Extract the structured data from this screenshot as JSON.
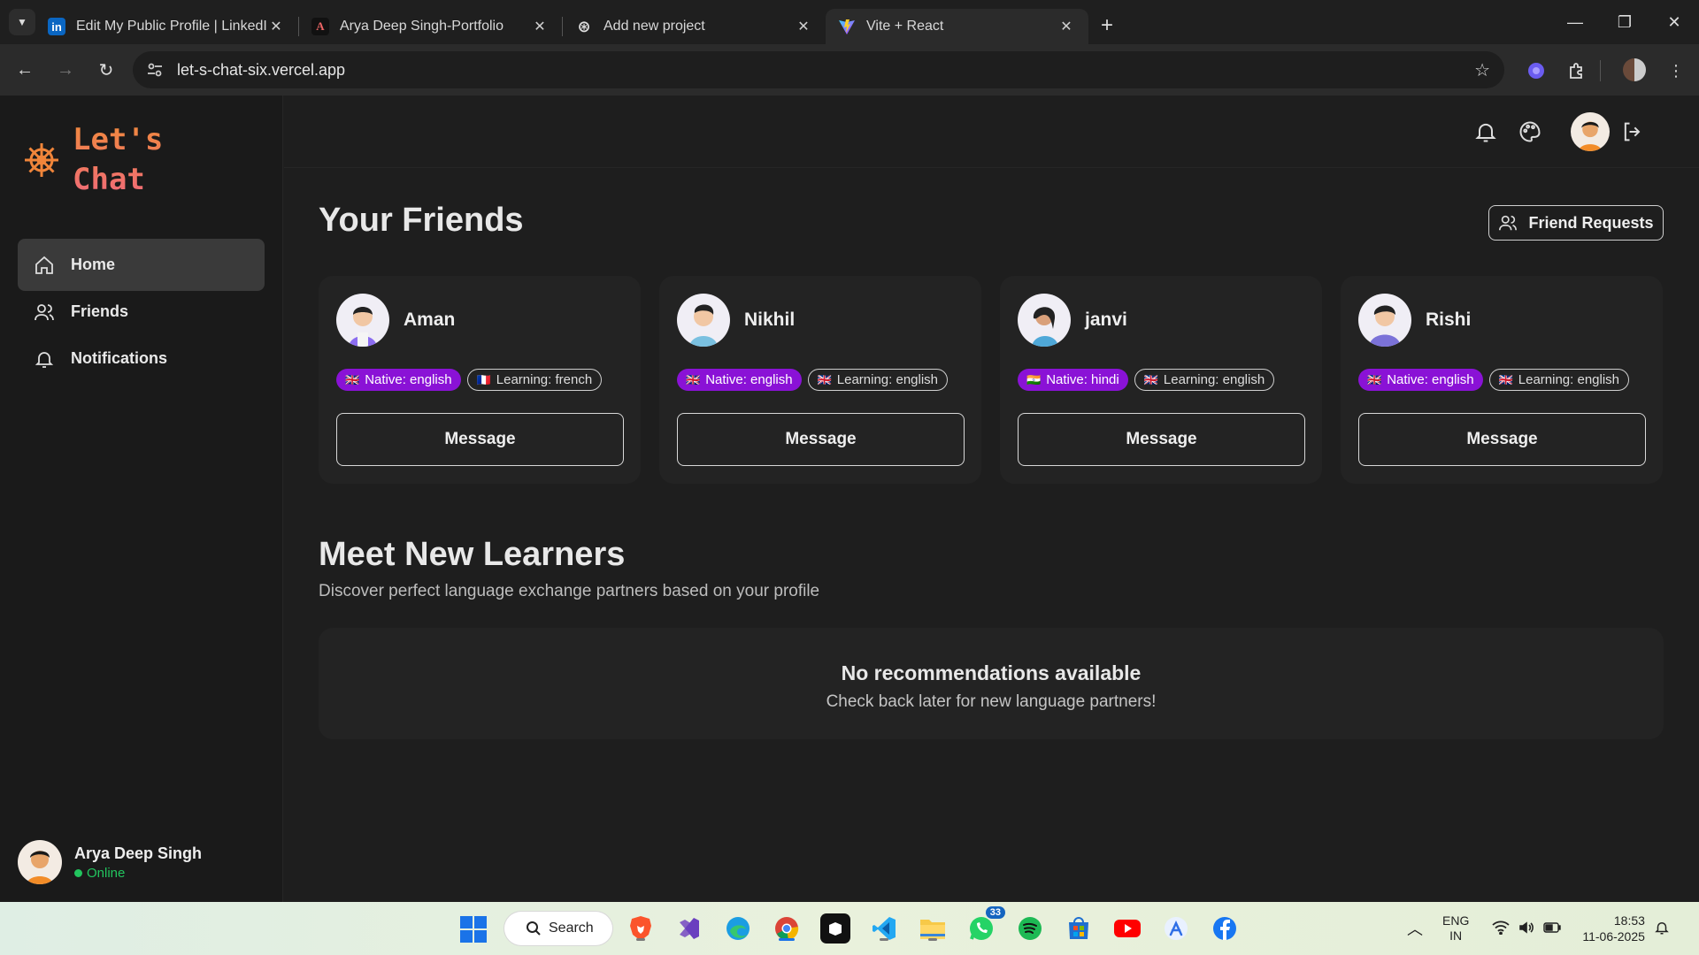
{
  "browser": {
    "tabs": [
      {
        "title": "Edit My Public Profile | LinkedIn",
        "icon": "linkedin-icon",
        "active": false
      },
      {
        "title": "Arya Deep Singh-Portfolio",
        "icon": "portfolio-icon",
        "active": false
      },
      {
        "title": "Add new project",
        "icon": "openai-icon",
        "active": false
      },
      {
        "title": "Vite + React",
        "icon": "vite-icon",
        "active": true
      }
    ],
    "url": "let-s-chat-six.vercel.app"
  },
  "app": {
    "brand": "Let's\nChat",
    "brand_color": "#f0853a",
    "nav": [
      {
        "label": "Home",
        "icon": "home-icon",
        "active": true
      },
      {
        "label": "Friends",
        "icon": "users-icon",
        "active": false
      },
      {
        "label": "Notifications",
        "icon": "bell-icon",
        "active": false
      }
    ],
    "user": {
      "name": "Arya Deep Singh",
      "status": "Online"
    },
    "friends_title": "Your Friends",
    "friend_requests_label": "Friend Requests",
    "friends": [
      {
        "name": "Aman",
        "native": "Native: english",
        "native_flag": "🇬🇧",
        "learning": "Learning: french",
        "learning_flag": "🇫🇷",
        "action": "Message"
      },
      {
        "name": "Nikhil",
        "native": "Native: english",
        "native_flag": "🇬🇧",
        "learning": "Learning: english",
        "learning_flag": "🇬🇧",
        "action": "Message"
      },
      {
        "name": "janvi",
        "native": "Native: hindi",
        "native_flag": "🇮🇳",
        "learning": "Learning: english",
        "learning_flag": "🇬🇧",
        "action": "Message"
      },
      {
        "name": "Rishi",
        "native": "Native: english",
        "native_flag": "🇬🇧",
        "learning": "Learning: english",
        "learning_flag": "🇬🇧",
        "action": "Message"
      }
    ],
    "learners_title": "Meet New Learners",
    "learners_subtitle": "Discover perfect language exchange partners based on your profile",
    "empty_title": "No recommendations available",
    "empty_text": "Check back later for new language partners!",
    "accent_native": "#8a12d6"
  },
  "taskbar": {
    "search_label": "Search",
    "whatsapp_badge": "33",
    "lang": "ENG",
    "region": "IN",
    "time": "18:53",
    "date": "11-06-2025"
  }
}
